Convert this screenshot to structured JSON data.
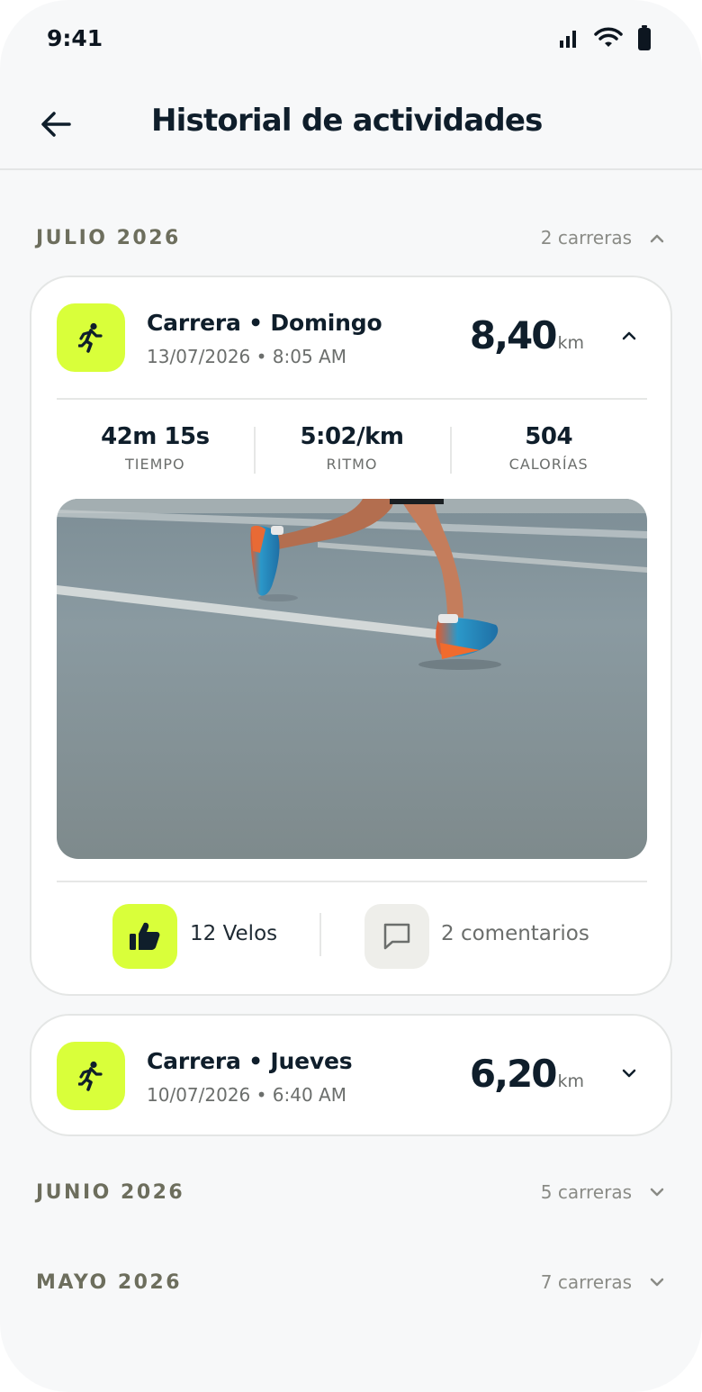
{
  "status": {
    "time": "9:41"
  },
  "header": {
    "title": "Historial de actividades"
  },
  "months": [
    {
      "title": "JULIO 2026",
      "count": "2 carreras",
      "expanded": true
    },
    {
      "title": "JUNIO 2026",
      "count": "5 carreras",
      "expanded": false
    },
    {
      "title": "MAYO 2026",
      "count": "7 carreras",
      "expanded": false
    }
  ],
  "activities": [
    {
      "title": "Carrera • Domingo",
      "date": "13/07/2026 • 8:05 AM",
      "distance": "8,40",
      "unit": "km",
      "expanded": true,
      "stats": [
        {
          "value": "42m 15s",
          "label": "TIEMPO"
        },
        {
          "value": "5:02/km",
          "label": "RITMO"
        },
        {
          "value": "504",
          "label": "CALORÍAS"
        }
      ],
      "likes": "12 Velos",
      "comments": "2 comentarios"
    },
    {
      "title": "Carrera • Jueves",
      "date": "10/07/2026 • 6:40 AM",
      "distance": "6,20",
      "unit": "km",
      "expanded": false
    }
  ],
  "colors": {
    "accent": "#d9ff3a",
    "text": "#0f1e2b",
    "muted": "#6b6e6c",
    "background": "#f7f8f9"
  },
  "icons": [
    "signal-icon",
    "wifi-icon",
    "battery-icon",
    "back-arrow-icon",
    "runner-icon",
    "chevron-up-icon",
    "chevron-down-icon",
    "thumbs-up-icon",
    "comment-icon"
  ]
}
